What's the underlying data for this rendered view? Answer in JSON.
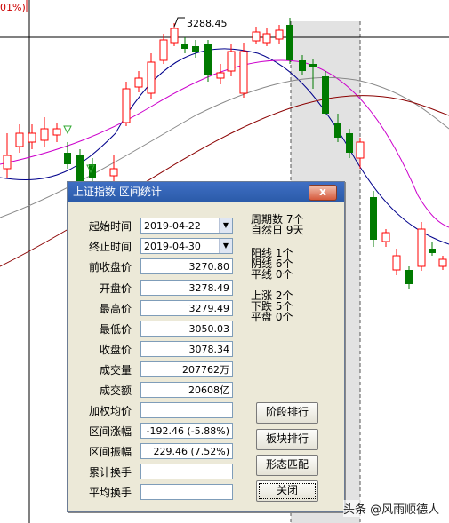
{
  "chart": {
    "corner_pct": "01%)",
    "high_label": "3288.45",
    "colors": {
      "up": "#ff0000",
      "down": "#007a00",
      "ma_blue": "#00008b",
      "ma_magenta": "#cc00cc",
      "ma_gray": "#888888",
      "ma_darkred": "#8b0000",
      "selection": "#e2e2e2"
    }
  },
  "dialog": {
    "title": "上证指数 区间统计",
    "close_glyph": "x",
    "fields": [
      {
        "label": "起始时间",
        "value": "2019-04-22",
        "type": "select"
      },
      {
        "label": "终止时间",
        "value": "2019-04-30",
        "type": "select"
      },
      {
        "label": "前收盘价",
        "value": "3270.80"
      },
      {
        "label": "开盘价",
        "value": "3278.49"
      },
      {
        "label": "最高价",
        "value": "3279.49"
      },
      {
        "label": "最低价",
        "value": "3050.03"
      },
      {
        "label": "收盘价",
        "value": "3078.34"
      },
      {
        "label": "成交量",
        "value": "207762万"
      },
      {
        "label": "成交额",
        "value": "20608亿"
      },
      {
        "label": "加权均价",
        "value": ""
      },
      {
        "label": "区间涨幅",
        "value": "-192.46 (-5.88%)"
      },
      {
        "label": "区间振幅",
        "value": "229.46 (7.52%)"
      },
      {
        "label": "累计换手",
        "value": ""
      },
      {
        "label": "平均换手",
        "value": ""
      }
    ],
    "stats": [
      {
        "label": "周期数",
        "value": "7个"
      },
      {
        "label": "自然日",
        "value": "9天"
      },
      {
        "label": "阳线",
        "value": "1个"
      },
      {
        "label": "阴线",
        "value": "6个"
      },
      {
        "label": "平线",
        "value": "0个"
      },
      {
        "label": "上涨",
        "value": "2个"
      },
      {
        "label": "下跌",
        "value": "5个"
      },
      {
        "label": "平盘",
        "value": "0个"
      }
    ],
    "buttons": {
      "stage_rank": "阶段排行",
      "sector_rank": "板块排行",
      "pattern_match": "形态匹配",
      "close": "关闭"
    }
  },
  "watermark": "头条 @风雨顺德人"
}
